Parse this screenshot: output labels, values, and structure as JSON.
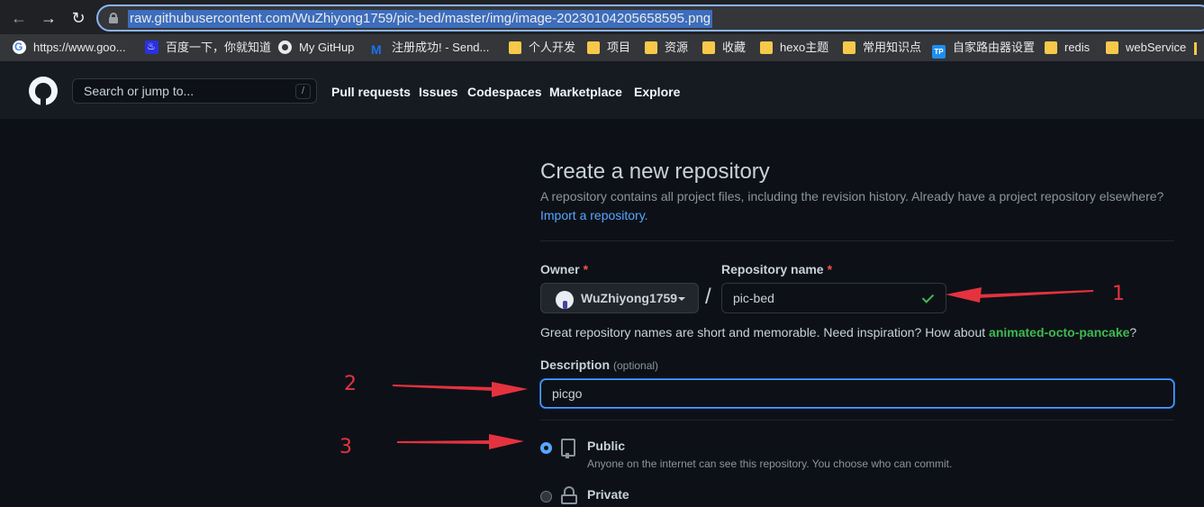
{
  "browser": {
    "url": "raw.githubusercontent.com/WuZhiyong1759/pic-bed/master/img/image-20230104205658595.png",
    "bookmarks": [
      {
        "label": "https://www.goo...",
        "icon": "google-icon"
      },
      {
        "label": "百度一下，你就知道",
        "icon": "baidu-icon"
      },
      {
        "label": "My GitHup",
        "icon": "github-icon"
      },
      {
        "label": "注册成功! - Send...",
        "icon": "sendcloud-icon"
      },
      {
        "label": "个人开发",
        "icon": "folder-icon"
      },
      {
        "label": "项目",
        "icon": "folder-icon"
      },
      {
        "label": "资源",
        "icon": "folder-icon"
      },
      {
        "label": "收藏",
        "icon": "folder-icon"
      },
      {
        "label": "hexo主题",
        "icon": "folder-icon"
      },
      {
        "label": "常用知识点",
        "icon": "folder-icon"
      },
      {
        "label": "自家路由器设置",
        "icon": "tplink-icon"
      },
      {
        "label": "redis",
        "icon": "folder-icon"
      },
      {
        "label": "webService",
        "icon": "folder-icon"
      }
    ]
  },
  "header": {
    "search_placeholder": "Search or jump to...",
    "search_shortcut": "/",
    "nav": [
      "Pull requests",
      "Issues",
      "Codespaces",
      "Marketplace",
      "Explore"
    ]
  },
  "form": {
    "title": "Create a new repository",
    "subtitle": "A repository contains all project files, including the revision history. Already have a project repository elsewhere?",
    "import_link": "Import a repository.",
    "owner_label": "Owner",
    "owner_value": "WuZhiyong1759",
    "repo_label": "Repository name",
    "required_mark": "*",
    "separator": "/",
    "repo_value": "pic-bed",
    "hint_prefix": "Great repository names are short and memorable. Need inspiration? How about ",
    "hint_suggestion": "animated-octo-pancake",
    "hint_suffix": "?",
    "description_label": "Description",
    "description_optional": "(optional)",
    "description_value": "picgo",
    "visibility": {
      "public_label": "Public",
      "public_desc": "Anyone on the internet can see this repository. You choose who can commit.",
      "public_selected": true,
      "private_label": "Private"
    }
  },
  "annotations": {
    "one": "1",
    "two": "2",
    "three": "3",
    "color": "#e5323f"
  },
  "colors": {
    "accent": "#58a6ff",
    "success": "#3fb950",
    "danger": "#f85149"
  }
}
